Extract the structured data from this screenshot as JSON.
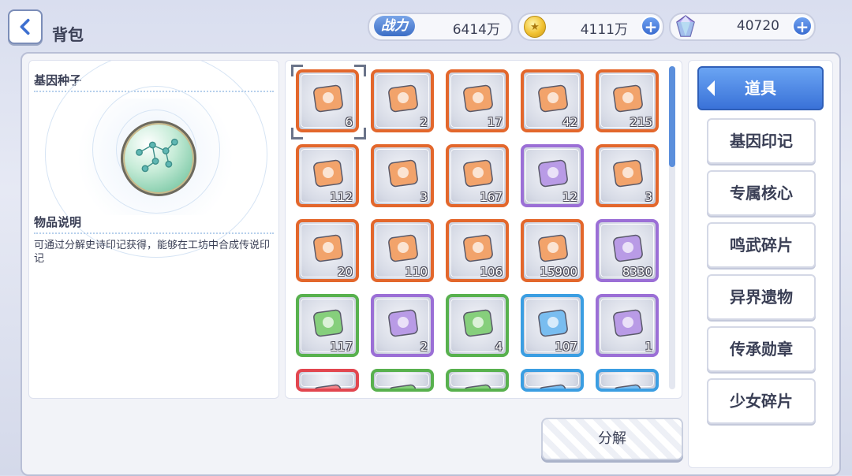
{
  "header": {
    "title": "背包",
    "back_icon": "chevron-left-icon"
  },
  "stats": {
    "power_label": "战力",
    "power_value": "6414万",
    "gold_value": "4111万",
    "gem_value": "40720"
  },
  "detail": {
    "item_name": "基因种子",
    "desc_title": "物品说明",
    "desc_text": "可通过分解史诗印记获得，能够在工坊中合成传说印记"
  },
  "items": [
    {
      "count": "6",
      "rarity": "orange",
      "icon": "gene-seed-orb-icon"
    },
    {
      "count": "2",
      "rarity": "orange",
      "icon": "pink-ticket-icon"
    },
    {
      "count": "17",
      "rarity": "orange",
      "icon": "silhouette-card-icon"
    },
    {
      "count": "42",
      "rarity": "orange",
      "icon": "gift-box-icon"
    },
    {
      "count": "215",
      "rarity": "orange",
      "icon": "gift-bouquet-icon"
    },
    {
      "count": "112",
      "rarity": "orange",
      "icon": "star-box-icon"
    },
    {
      "count": "3",
      "rarity": "orange",
      "icon": "cauldron-icon"
    },
    {
      "count": "167",
      "rarity": "orange",
      "icon": "clothes-ticket-icon"
    },
    {
      "count": "12",
      "rarity": "purple",
      "icon": "smile-ticket-icon"
    },
    {
      "count": "3",
      "rarity": "orange",
      "icon": "gold-card-icon"
    },
    {
      "count": "20",
      "rarity": "orange",
      "icon": "dna-card-icon"
    },
    {
      "count": "110",
      "rarity": "orange",
      "icon": "rainbow-ticket-icon"
    },
    {
      "count": "106",
      "rarity": "orange",
      "icon": "sword-card-icon"
    },
    {
      "count": "15900",
      "rarity": "orange",
      "icon": "crystal-icon"
    },
    {
      "count": "8330",
      "rarity": "purple",
      "icon": "green-vial-icon"
    },
    {
      "count": "117",
      "rarity": "green",
      "icon": "cookie-icon"
    },
    {
      "count": "2",
      "rarity": "purple",
      "icon": "canned-food-icon"
    },
    {
      "count": "4",
      "rarity": "green",
      "icon": "chip-icon"
    },
    {
      "count": "107",
      "rarity": "blue",
      "icon": "chip-icon"
    },
    {
      "count": "1",
      "rarity": "purple",
      "icon": "circuit-chip-icon"
    },
    {
      "count": "",
      "rarity": "red",
      "icon": "red-card-icon"
    },
    {
      "count": "",
      "rarity": "green",
      "icon": "blue-shard-icon"
    },
    {
      "count": "",
      "rarity": "green",
      "icon": "purple-shard-icon"
    },
    {
      "count": "",
      "rarity": "blue",
      "icon": "star-shard-icon"
    },
    {
      "count": "",
      "rarity": "blue",
      "icon": "chip-piece-icon"
    }
  ],
  "tabs": {
    "active": "道具",
    "items": [
      "基因印记",
      "专属核心",
      "鸣武碎片",
      "异界遗物",
      "传承勋章",
      "少女碎片"
    ]
  },
  "actions": {
    "decompose_label": "分解"
  }
}
